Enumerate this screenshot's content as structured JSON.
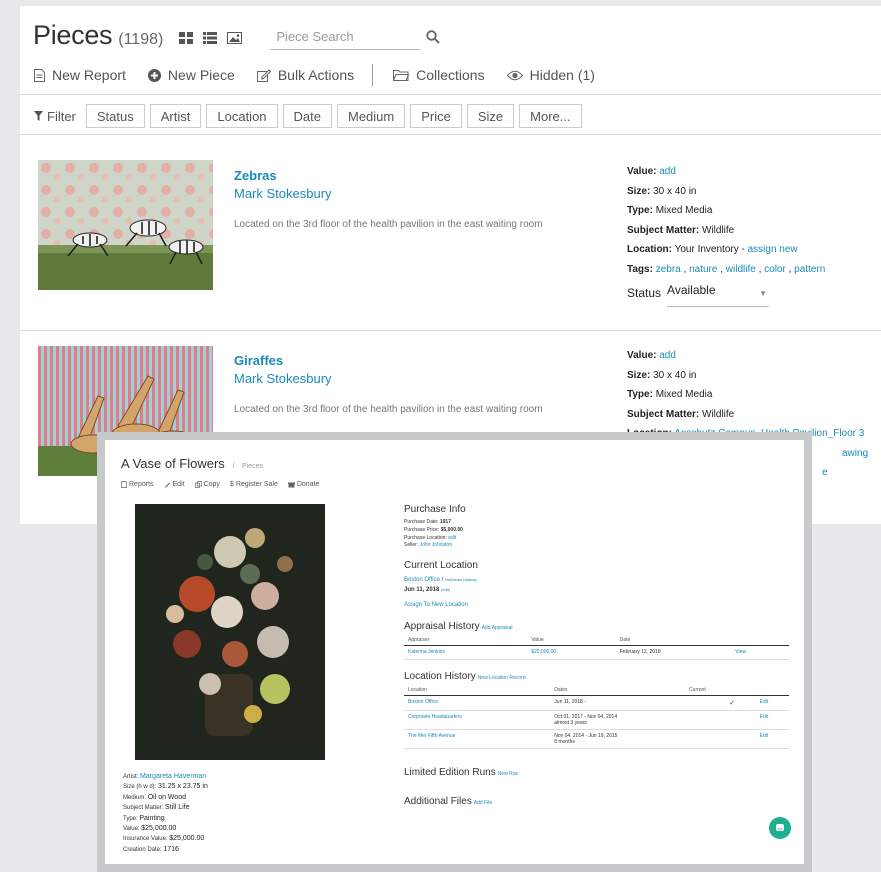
{
  "header": {
    "title": "Pieces",
    "count": "(1198)",
    "search_placeholder": "Piece Search"
  },
  "toolbar": {
    "new_report": "New Report",
    "new_piece": "New Piece",
    "bulk_actions": "Bulk Actions",
    "collections": "Collections",
    "hidden": "Hidden (1)"
  },
  "filters": {
    "label": "Filter",
    "buttons": [
      "Status",
      "Artist",
      "Location",
      "Date",
      "Medium",
      "Price",
      "Size",
      "More..."
    ]
  },
  "pieces": [
    {
      "title": "Zebras",
      "artist": "Mark Stokesbury",
      "description": "Located on the 3rd floor of the health pavilion in the east waiting room",
      "value_label": "Value:",
      "value": "add",
      "size_label": "Size:",
      "size": "30 x 40 in",
      "type_label": "Type:",
      "type": "Mixed Media",
      "subject_label": "Subject Matter:",
      "subject": "Wildlife",
      "location_label": "Location:",
      "location": "Your Inventory -",
      "location_action": "assign new",
      "tags_label": "Tags:",
      "tags": [
        "zebra",
        "nature",
        "wildlife",
        "color",
        "pattern"
      ],
      "status_label": "Status",
      "status": "Available"
    },
    {
      "title": "Giraffes",
      "artist": "Mark Stokesbury",
      "description": "Located on the 3rd floor of the health pavilion in the east waiting room",
      "value_label": "Value:",
      "value": "add",
      "size_label": "Size:",
      "size": "30 x 40 in",
      "type_label": "Type:",
      "type": "Mixed Media",
      "subject_label": "Subject Matter:",
      "subject": "Wildlife",
      "location_label": "Location:",
      "location": "Anschutz Campus_Health Pavilion_Floor 3",
      "peek1": "awing",
      "peek2": "e"
    }
  ],
  "modal": {
    "title": "A Vase of Flowers",
    "crumb_sep": "/",
    "crumb": "Pieces",
    "actions": [
      "Reports",
      "Edit",
      "Copy",
      "Register Sale",
      "Donate"
    ],
    "meta": [
      {
        "label": "Artist:",
        "value": "Margareta Haverman",
        "link": true
      },
      {
        "label": "Size (h w d):",
        "value": "31.25 x 23.75 in"
      },
      {
        "label": "Medium:",
        "value": "Oil on Wood"
      },
      {
        "label": "Subject Matter:",
        "value": "Still Life"
      },
      {
        "label": "Type:",
        "value": "Painting"
      },
      {
        "label": "Value:",
        "value": "$25,000.00"
      },
      {
        "label": "Insurance Value:",
        "value": "$25,000.00"
      },
      {
        "label": "Creation Date:",
        "value": "1716"
      }
    ],
    "purchase": {
      "heading": "Purchase Info",
      "date_label": "Purchase Date:",
      "date": "1917",
      "price_label": "Purchase Price:",
      "price": "$5,000.00",
      "location_label": "Purchase Location:",
      "location": "edit",
      "seller_label": "Seller:",
      "seller": "John Johnston"
    },
    "current_location": {
      "heading": "Current Location",
      "place": "Boston Office",
      "sep": "/",
      "sub": "Northeast hallway",
      "date": "Jun 11, 2018",
      "date_edit": "(edit)",
      "assign": "Assign To New Location"
    },
    "appraisal": {
      "heading": "Appraisal History",
      "add": "Add Appraisal",
      "columns": [
        "Appraiser",
        "Value",
        "Date",
        ""
      ],
      "rows": [
        [
          "Katerina Jenkins",
          "$25,000.00",
          "February 12, 2018",
          "View"
        ]
      ]
    },
    "location_history": {
      "heading": "Location History",
      "add": "New Location Record",
      "columns": [
        "Location",
        "Dates",
        "Current",
        ""
      ],
      "rows": [
        {
          "location": "Boston Office",
          "dates": "Jun 11, 2018 -",
          "dates2": "",
          "current": "✓",
          "action": "Edit"
        },
        {
          "location": "Corporate Headquarters",
          "dates": "Oct 01, 2017 - Nov 04, 2014",
          "dates2": "almost 3 years",
          "current": "",
          "action": "Edit"
        },
        {
          "location": "The Met Fifth Avenue",
          "dates": "Nov 04, 2014 - Jun 19, 2015",
          "dates2": "8 months",
          "current": "",
          "action": "Edit"
        }
      ]
    },
    "limited_edition": {
      "heading": "Limited Edition Runs",
      "add": "New Run"
    },
    "additional_files": {
      "heading": "Additional Files",
      "add": "Add File"
    }
  },
  "colors": {
    "link": "#1a8bb8",
    "chat": "#1bb08e"
  },
  "icons": [
    "grid-view-icon",
    "list-view-icon",
    "image-view-icon",
    "search-icon",
    "report-icon",
    "plus-circle-icon",
    "edit-icon",
    "folder-icon",
    "eye-icon",
    "filter-icon",
    "chat-icon"
  ]
}
